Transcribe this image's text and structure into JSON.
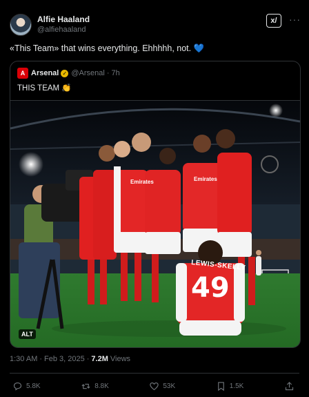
{
  "author": {
    "name": "Alfie Haaland",
    "handle": "@alfiehaaland"
  },
  "tweet": {
    "text": "«This Team» that wins everything. Ehhhhh, not. 💙"
  },
  "quoted": {
    "logo_text": "A",
    "name": "Arsenal",
    "handle": "@Arsenal",
    "separator": "·",
    "time": "7h",
    "text": "THIS TEAM 👏",
    "alt_label": "ALT",
    "shirt_name": "LEWIS-SKELLY",
    "shirt_number": "49",
    "sponsor": "Emirates"
  },
  "meta": {
    "time": "1:30 AM",
    "dot": "·",
    "date": "Feb 3, 2025",
    "dot2": "·",
    "views": "7.2M",
    "views_label": "Views"
  },
  "actions": {
    "replies": "5.8K",
    "reposts": "8.8K",
    "likes": "53K",
    "bookmarks": "1.5K"
  },
  "header_icons": {
    "grok": "grok-icon",
    "more": "more-icon"
  },
  "colors": {
    "background": "#000000",
    "arsenal_red": "#db0007",
    "pitch": "#2e7d2e",
    "muted": "#71767b"
  }
}
